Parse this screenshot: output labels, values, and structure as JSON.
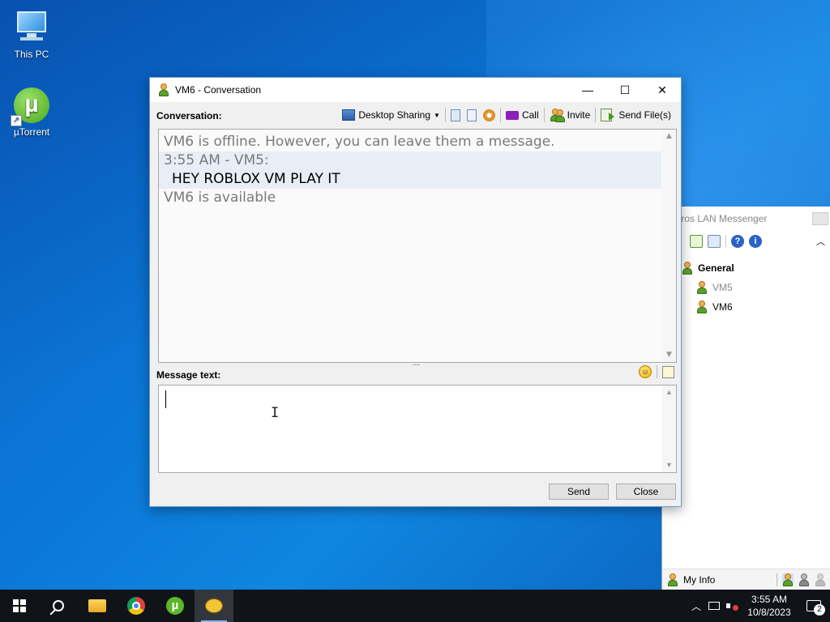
{
  "desktop": {
    "icons": [
      {
        "label": "This PC",
        "icon": "this-pc-icon"
      },
      {
        "label": "µTorrent",
        "icon": "utorrent-icon"
      }
    ]
  },
  "messenger": {
    "title": "tros LAN Messenger",
    "groups": [
      {
        "name": "General",
        "users": [
          {
            "name": "VM5",
            "status": "offline"
          },
          {
            "name": "VM6",
            "status": "online"
          }
        ]
      }
    ],
    "my_info_label": "My Info"
  },
  "conversation": {
    "title": "VM6 - Conversation",
    "conversation_label": "Conversation:",
    "toolbar": {
      "desktop_sharing": "Desktop Sharing",
      "call": "Call",
      "invite": "Invite",
      "send_files": "Send File(s)"
    },
    "log": {
      "offline_notice": "VM6 is offline. However, you can leave them a message.",
      "message_header": "3:55 AM - VM5:",
      "message_body": "HEY ROBLOX VM PLAY IT",
      "available_notice": "VM6 is available"
    },
    "message_label": "Message text:",
    "message_value": "",
    "send_label": "Send",
    "close_label": "Close",
    "splitter_glyph": "····",
    "cursor_glyph": "I",
    "emoji_glyph": "☺"
  },
  "window_controls": {
    "minimize": "—",
    "maximize": "☐",
    "close": "✕"
  },
  "taskbar": {
    "clock_time": "3:55 AM",
    "clock_date": "10/8/2023",
    "notification_count": "2",
    "tray_chevron": "︿"
  },
  "colors": {
    "accent": "#0a78d7",
    "window_border": "#6b9bd1",
    "system_text": "#7a7a7a"
  }
}
